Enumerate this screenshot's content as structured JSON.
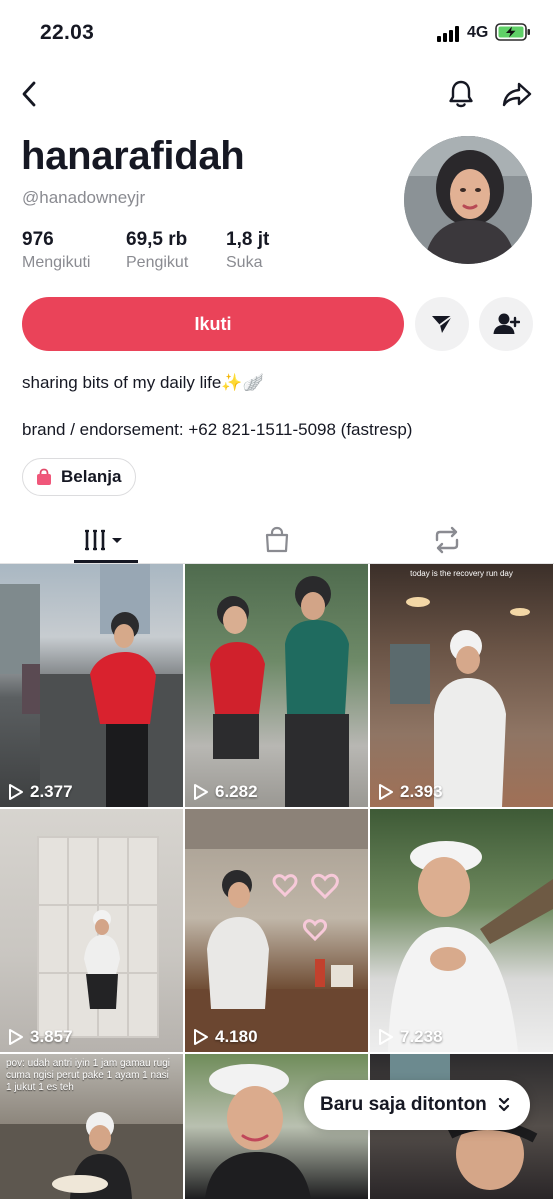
{
  "status_bar": {
    "time": "22.03",
    "network": "4G"
  },
  "profile": {
    "display_name": "hanarafidah",
    "handle": "@hanadowneyjr",
    "stats": [
      {
        "value": "976",
        "label": "Mengikuti"
      },
      {
        "value": "69,5 rb",
        "label": "Pengikut"
      },
      {
        "value": "1,8 jt",
        "label": "Suka"
      }
    ],
    "follow_label": "Ikuti",
    "bio": [
      "sharing bits of my daily life✨🪽",
      "brand / endorsement: +62 821-1511-5098 (fastresp)"
    ],
    "shop_label": "Belanja"
  },
  "videos": [
    {
      "views": "2.377"
    },
    {
      "views": "6.282"
    },
    {
      "views": "2.393",
      "overlay_text": "today is the recovery run day"
    },
    {
      "views": "3.857"
    },
    {
      "views": "4.180"
    },
    {
      "views": "7.238"
    },
    {
      "views": "",
      "overlay_text": "pov: udah antri iyin 1 jam gamau rugi cuma ngisi perut pake 1 ayam 1 nasi 1 jukut 1 es teh"
    },
    {
      "views": ""
    },
    {
      "views": ""
    }
  ],
  "recently_watched_label": "Baru saja ditonton",
  "colors": {
    "accent": "#ea4359",
    "text": "#161823",
    "muted": "#8a8b91"
  }
}
